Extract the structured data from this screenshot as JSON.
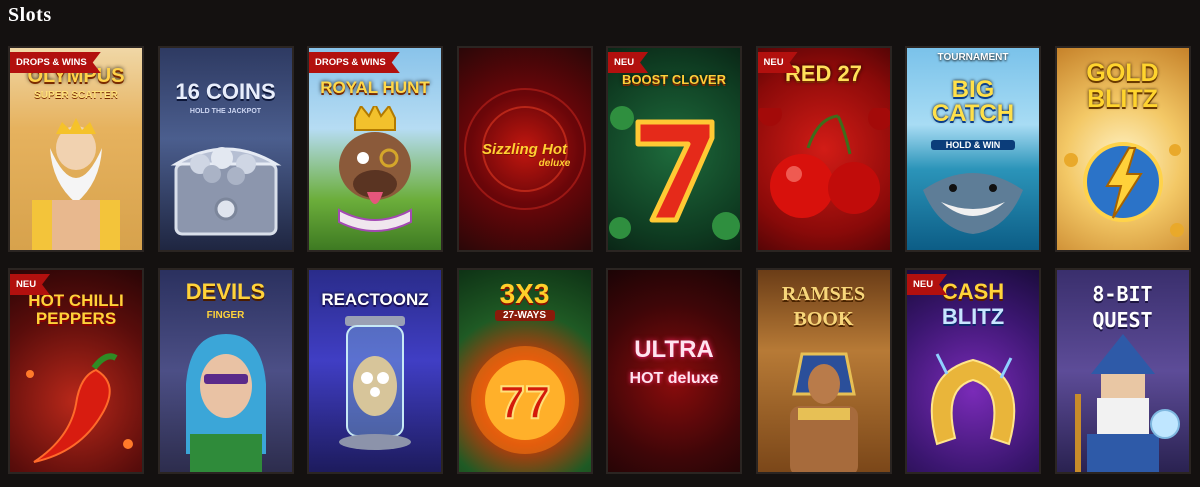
{
  "section": {
    "title": "Slots"
  },
  "tiles": [
    {
      "badge": "DROPS & WINS",
      "title": "OLYMPUS",
      "subtitle": "SUPER SCATTER"
    },
    {
      "badge": "",
      "title": "16 COINS",
      "subtitle": "HOLD THE JACKPOT"
    },
    {
      "badge": "DROPS & WINS",
      "title": "ROYAL HUNT",
      "subtitle": ""
    },
    {
      "badge": "",
      "title": "Sizzling Hot",
      "subtitle": "deluxe"
    },
    {
      "badge": "NEU",
      "title": "BOOST CLOVER",
      "subtitle": ""
    },
    {
      "badge": "NEU",
      "title": "RED 27",
      "subtitle": ""
    },
    {
      "badge": "",
      "title": "BIG CATCH",
      "subtitle": "HOLD & WIN",
      "kicker": "TOURNAMENT"
    },
    {
      "badge": "",
      "title": "GOLD BLITZ",
      "subtitle": ""
    },
    {
      "badge": "NEU",
      "title": "HOT CHILLI PEPPERS",
      "subtitle": ""
    },
    {
      "badge": "",
      "title": "DEVILS",
      "subtitle": "FINGER"
    },
    {
      "badge": "",
      "title": "REACTOONZ",
      "subtitle": ""
    },
    {
      "badge": "",
      "title": "3X3",
      "subtitle": "27-WAYS"
    },
    {
      "badge": "",
      "title": "ULTRA",
      "subtitle": "HOT deluxe"
    },
    {
      "badge": "",
      "title": "RAMSES",
      "subtitle": "BOOK"
    },
    {
      "badge": "NEU",
      "title": "CASH",
      "subtitle": "BLITZ"
    },
    {
      "badge": "",
      "title": "8-BIT",
      "subtitle": "QUEST"
    }
  ]
}
